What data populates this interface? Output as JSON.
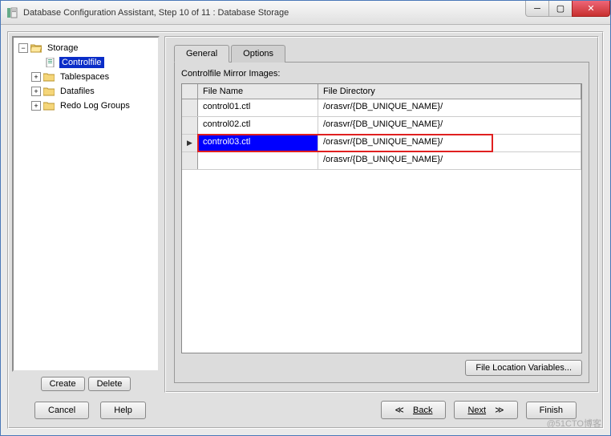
{
  "window": {
    "title": "Database Configuration Assistant, Step 10 of 11 : Database Storage"
  },
  "tree": {
    "root": "Storage",
    "items": [
      "Controlfile",
      "Tablespaces",
      "Datafiles",
      "Redo Log Groups"
    ],
    "selected_index": 0,
    "buttons": {
      "create": "Create",
      "delete": "Delete"
    }
  },
  "tabs": {
    "general": "General",
    "options": "Options",
    "active": 0
  },
  "section_label": "Controlfile Mirror Images:",
  "grid": {
    "headers": {
      "file_name": "File Name",
      "file_directory": "File Directory"
    },
    "rows": [
      {
        "file_name": "control01.ctl",
        "file_directory": "/orasvr/{DB_UNIQUE_NAME}/"
      },
      {
        "file_name": "control02.ctl",
        "file_directory": "/orasvr/{DB_UNIQUE_NAME}/"
      },
      {
        "file_name": "control03.ctl",
        "file_directory": "/orasvr/{DB_UNIQUE_NAME}/"
      },
      {
        "file_name": "",
        "file_directory": "/orasvr/{DB_UNIQUE_NAME}/"
      }
    ],
    "selected_row": 2,
    "highlighted_row": 2
  },
  "right_bottom": {
    "file_loc": "File Location Variables..."
  },
  "footer": {
    "cancel": "Cancel",
    "help": "Help",
    "back": "Back",
    "next": "Next",
    "finish": "Finish"
  },
  "watermark": "@51CTO博客"
}
